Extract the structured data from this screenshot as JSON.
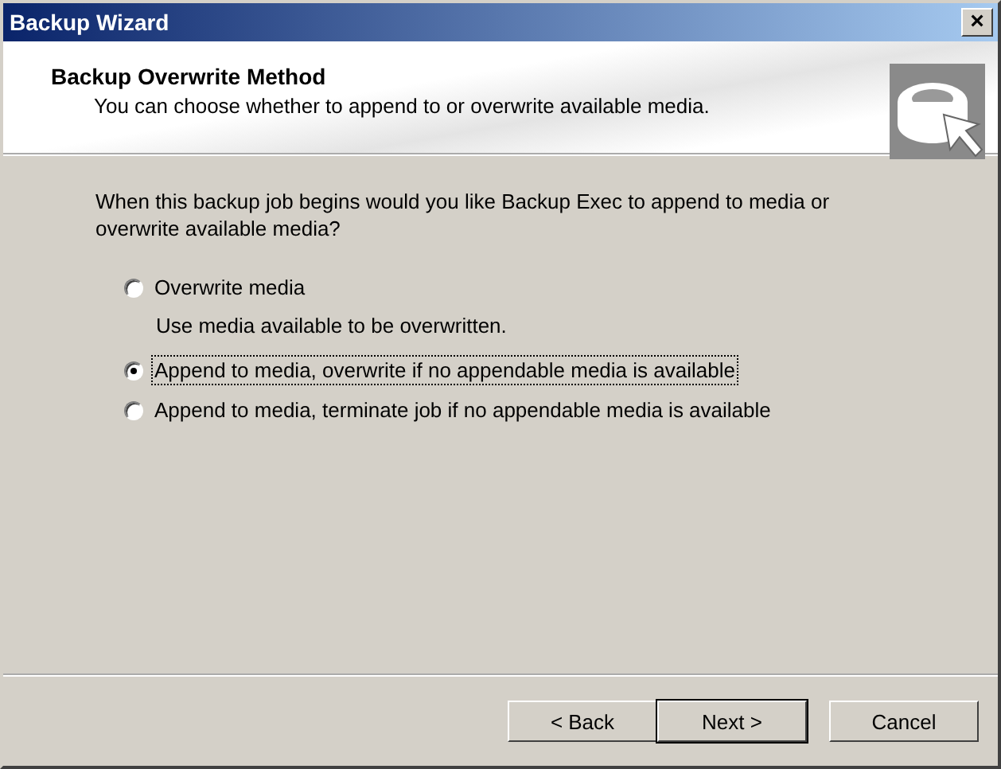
{
  "window": {
    "title": "Backup Wizard",
    "close": "×"
  },
  "header": {
    "title": "Backup Overwrite Method",
    "subtitle": "You can choose whether to append to or overwrite available media."
  },
  "question": "When this backup job begins would you like Backup Exec to append to media or overwrite available media?",
  "options": [
    {
      "label": "Overwrite media",
      "description": "Use media available to be overwritten.",
      "selected": false,
      "focused": false
    },
    {
      "label": "Append to media, overwrite if no appendable media is available",
      "selected": true,
      "focused": true
    },
    {
      "label": "Append to media, terminate job if no appendable media is available",
      "selected": false,
      "focused": false
    }
  ],
  "buttons": [
    {
      "label": "< Back",
      "default": false
    },
    {
      "label": "Next >",
      "default": true
    },
    {
      "label": "Cancel",
      "default": false
    }
  ]
}
